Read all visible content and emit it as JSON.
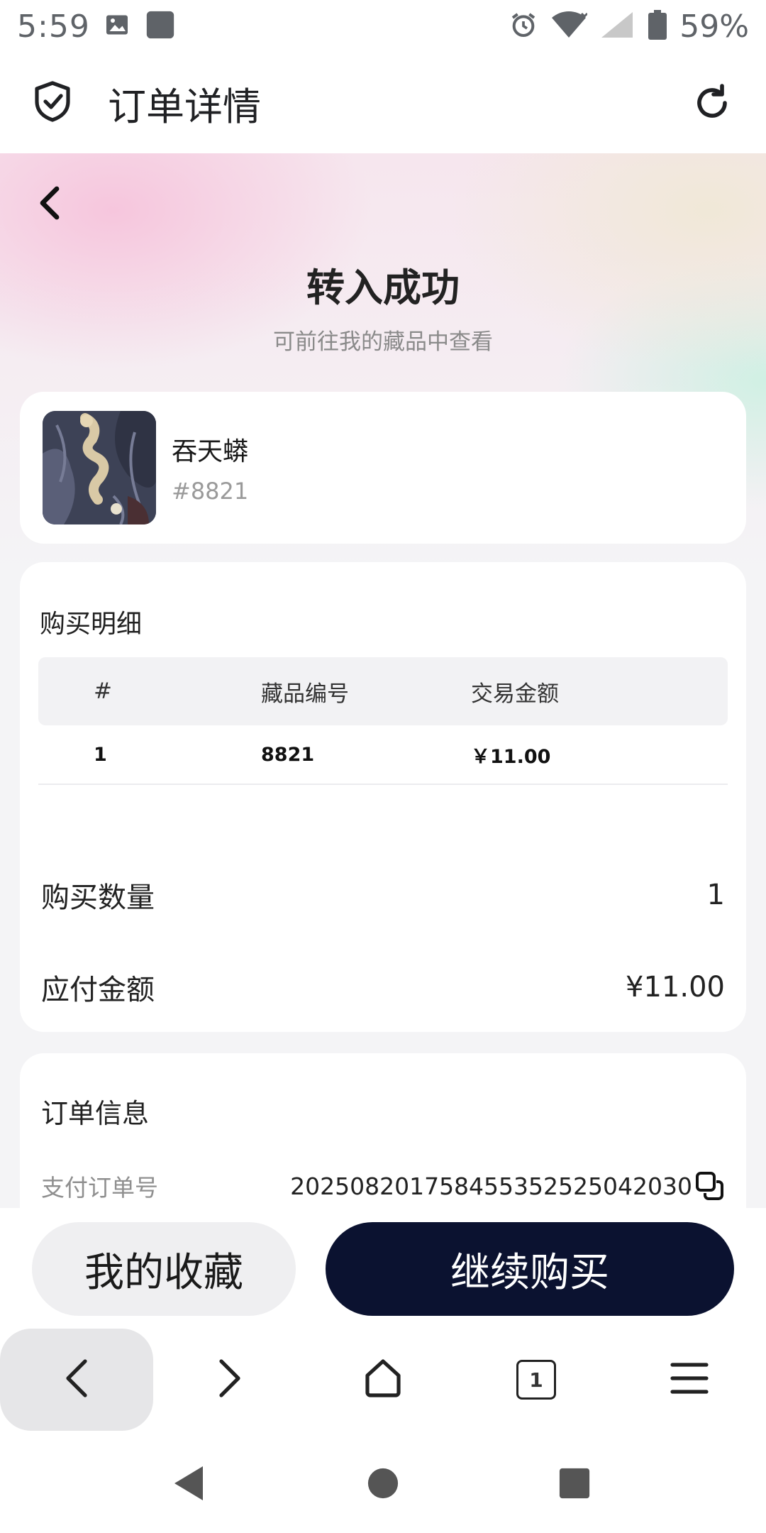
{
  "status_bar": {
    "time": "5:59",
    "battery": "59%",
    "icons": [
      "image-icon",
      "app-square-icon",
      "alarm-icon",
      "wifi-icon",
      "signal-icon",
      "battery-icon"
    ]
  },
  "browser": {
    "title": "订单详情",
    "left_icon": "shield-check-icon",
    "right_icon": "refresh-icon"
  },
  "hero": {
    "title": "转入成功",
    "subtitle": "可前往我的藏品中查看"
  },
  "product": {
    "name": "吞天蟒",
    "serial": "#8821"
  },
  "purchase_detail": {
    "heading": "购买明细",
    "columns": [
      "#",
      "藏品编号",
      "交易金额"
    ],
    "rows": [
      {
        "index": "1",
        "item_no": "8821",
        "amount": "￥11.00"
      }
    ]
  },
  "summary": {
    "quantity_label": "购买数量",
    "quantity_value": "1",
    "payable_label": "应付金额",
    "payable_value": "¥11.00"
  },
  "order_info": {
    "heading": "订单信息",
    "pay_order_label": "支付订单号",
    "pay_order_value": "202508201758455352525042030"
  },
  "actions": {
    "collection_label": "我的收藏",
    "buy_label": "继续购买"
  },
  "browser_nav": {
    "tab_count": "1",
    "icons": [
      "back-icon",
      "forward-icon",
      "home-icon",
      "tabs-icon",
      "menu-icon"
    ]
  },
  "colors": {
    "primary_button": "#0b1230",
    "secondary_button": "#efeff1",
    "muted_text": "#8f8f8f"
  }
}
